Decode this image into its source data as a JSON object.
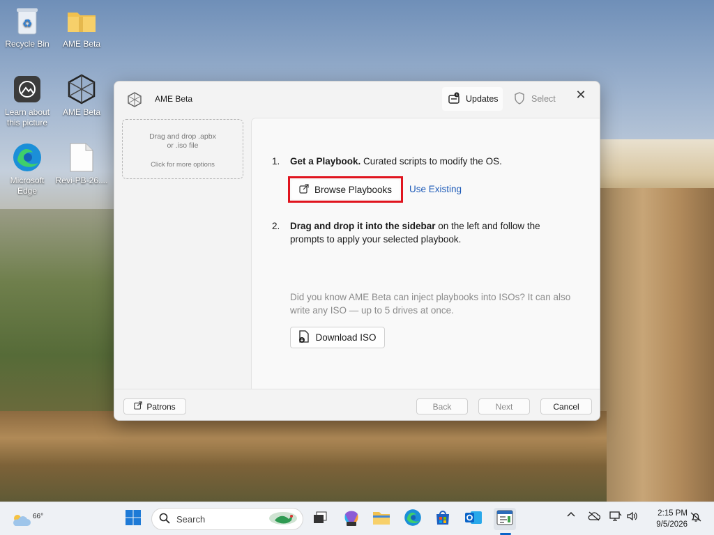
{
  "desktop": {
    "icons": [
      {
        "label": "Recycle Bin"
      },
      {
        "label": "AME Beta"
      },
      {
        "label": "Learn about this picture"
      },
      {
        "label": "AME Beta"
      },
      {
        "label": "Microsoft Edge"
      },
      {
        "label": "Revi-PB-26...."
      }
    ]
  },
  "window": {
    "title": "AME Beta",
    "tabs": {
      "updates": "Updates",
      "select": "Select"
    },
    "sidebar": {
      "drop_text": "Drag and drop .apbx",
      "drop_text2": "or .iso file",
      "drop_hint": "Click for more options"
    },
    "steps": [
      {
        "num": "1.",
        "bold": "Get a Playbook.",
        "text": " Curated scripts to modify the OS."
      },
      {
        "num": "2.",
        "bold": "Drag and drop it into the sidebar",
        "text": " on the left and follow the",
        "text2": "prompts to apply your selected playbook."
      }
    ],
    "browse_button": "Browse Playbooks",
    "use_existing_link": "Use Existing",
    "hint_line1": "Did you know AME Beta can inject playbooks into ISOs? It can also",
    "hint_line2": "write any ISO — up to 5 drives at once.",
    "download_iso_button": "Download ISO",
    "footer": {
      "patrons": "Patrons",
      "back": "Back",
      "next": "Next",
      "cancel": "Cancel"
    },
    "highlight_color": "#e0141e"
  },
  "taskbar": {
    "weather_temp": "66°",
    "search_placeholder": "Search",
    "time": "2:15 PM",
    "date": "9/5/2026"
  }
}
